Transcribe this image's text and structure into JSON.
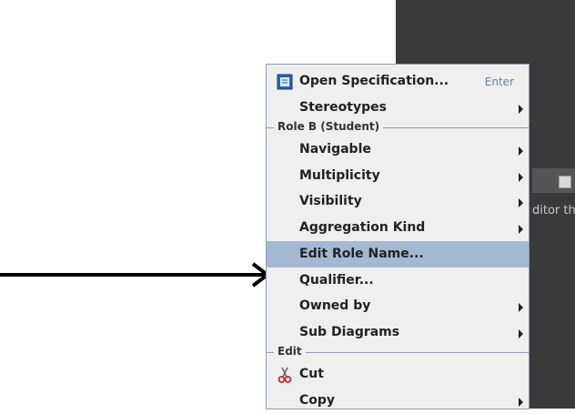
{
  "background_panel": {
    "side_text": "ditor that"
  },
  "menu": {
    "items_top": [
      {
        "label": "Open Specification...",
        "shortcut": "Enter",
        "icon": "specification-icon"
      },
      {
        "label": "Stereotypes",
        "submenu": true
      }
    ],
    "section_role": "Role B (Student)",
    "role_items": [
      {
        "label": "Navigable",
        "submenu": true
      },
      {
        "label": "Multiplicity",
        "submenu": true
      },
      {
        "label": "Visibility",
        "submenu": true
      },
      {
        "label": "Aggregation Kind",
        "submenu": true
      },
      {
        "label": "Edit Role Name...",
        "highlighted": true
      },
      {
        "label": "Qualifier..."
      },
      {
        "label": "Owned by",
        "submenu": true
      },
      {
        "label": "Sub Diagrams",
        "submenu": true
      }
    ],
    "section_edit": "Edit",
    "edit_items": [
      {
        "label": "Cut",
        "icon": "scissors-icon"
      },
      {
        "label": "Copy",
        "submenu": true
      }
    ]
  },
  "colors": {
    "highlight": "#a5b8d1",
    "menu_bg": "#efefef",
    "shortcut": "#6b7fa3"
  }
}
